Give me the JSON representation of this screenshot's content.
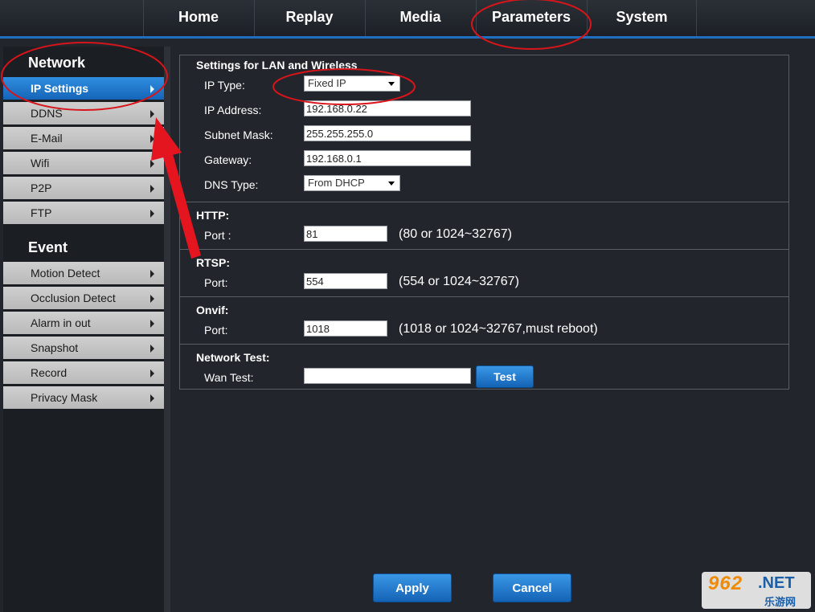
{
  "top_nav": {
    "items": [
      {
        "label": "Home"
      },
      {
        "label": "Replay"
      },
      {
        "label": "Media"
      },
      {
        "label": "Parameters"
      },
      {
        "label": "System"
      }
    ]
  },
  "sidebar": {
    "network_title": "Network",
    "network_items": [
      {
        "label": "IP Settings",
        "active": true
      },
      {
        "label": "DDNS"
      },
      {
        "label": "E-Mail"
      },
      {
        "label": "Wifi"
      },
      {
        "label": "P2P"
      },
      {
        "label": "FTP"
      }
    ],
    "event_title": "Event",
    "event_items": [
      {
        "label": "Motion Detect"
      },
      {
        "label": "Occlusion Detect"
      },
      {
        "label": "Alarm in out"
      },
      {
        "label": "Snapshot"
      },
      {
        "label": "Record"
      },
      {
        "label": "Privacy Mask"
      }
    ]
  },
  "lan": {
    "title": "Settings for LAN and Wireless",
    "ip_type_label": "IP Type:",
    "ip_type_value": "Fixed IP",
    "ip_address_label": "IP Address:",
    "ip_address_value": "192.168.0.22",
    "subnet_label": "Subnet Mask:",
    "subnet_value": "255.255.255.0",
    "gateway_label": "Gateway:",
    "gateway_value": "192.168.0.1",
    "dns_type_label": "DNS Type:",
    "dns_type_value": "From DHCP"
  },
  "http": {
    "title": "HTTP:",
    "port_label": "Port :",
    "port_value": "81",
    "hint": "(80 or 1024~32767)"
  },
  "rtsp": {
    "title": "RTSP:",
    "port_label": "Port:",
    "port_value": "554",
    "hint": "(554 or 1024~32767)"
  },
  "onvif": {
    "title": "Onvif:",
    "port_label": "Port:",
    "port_value": "1018",
    "hint": "(1018 or 1024~32767,must reboot)"
  },
  "network_test": {
    "title": "Network Test:",
    "wan_label": "Wan Test:",
    "wan_value": "",
    "test_button": "Test"
  },
  "actions": {
    "apply": "Apply",
    "cancel": "Cancel"
  },
  "watermark": {
    "main": "962",
    "net": ".NET",
    "sub": "乐游网"
  },
  "colors": {
    "accent": "#1f6fc0",
    "annotation": "#d8141b",
    "background": "#22262c"
  }
}
